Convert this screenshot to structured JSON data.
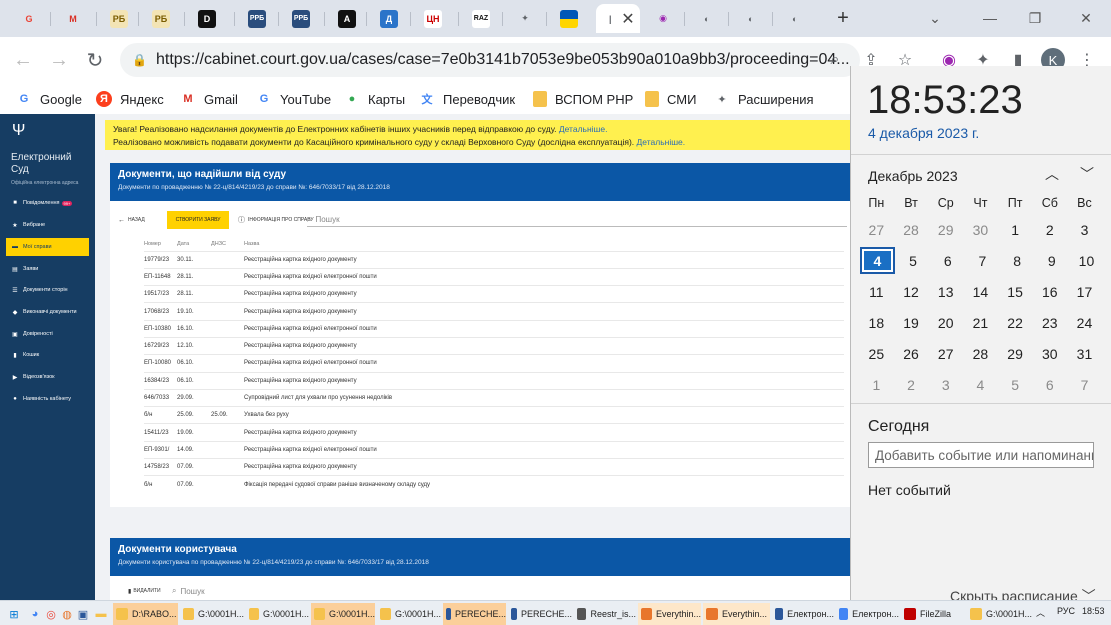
{
  "browser": {
    "tabs": [
      {
        "icon": "google-icon",
        "glyph": "G",
        "color": "#ea4335",
        "bg": "transparent"
      },
      {
        "icon": "gmail-icon",
        "glyph": "M",
        "color": "#d93025",
        "bg": "transparent"
      },
      {
        "icon": "newspaper-icon",
        "glyph": "РБ",
        "color": "#7a5c00",
        "bg": "#f3e4b5"
      },
      {
        "icon": "newspaper-icon",
        "glyph": "РБ",
        "color": "#7a5c00",
        "bg": "#f3e4b5"
      },
      {
        "icon": "site-d-icon",
        "glyph": "D",
        "color": "#fff",
        "bg": "#111"
      },
      {
        "icon": "site-rpb-icon",
        "glyph": "РРБ",
        "color": "#fff",
        "bg": "#2a4d7d"
      },
      {
        "icon": "site-rpb-icon",
        "glyph": "РРБ",
        "color": "#fff",
        "bg": "#2a4d7d"
      },
      {
        "icon": "site-a-icon",
        "glyph": "A",
        "color": "#fff",
        "bg": "#111"
      },
      {
        "icon": "site-d-blue-icon",
        "glyph": "Д",
        "color": "#fff",
        "bg": "#2b74c9"
      },
      {
        "icon": "site-cn-icon",
        "glyph": "ЦН",
        "color": "#c00",
        "bg": "#fff"
      },
      {
        "icon": "site-raz-icon",
        "glyph": "RAZ",
        "color": "#111",
        "bg": "#fff"
      },
      {
        "icon": "extension-icon",
        "glyph": "✦",
        "color": "#5f6368",
        "bg": "transparent"
      },
      {
        "icon": "ukraine-flag-icon",
        "glyph": "",
        "color": "#ffd500",
        "bg": "#0057b7"
      },
      {
        "icon": "court-emblem-icon",
        "glyph": "|",
        "color": "#5f6368",
        "bg": "transparent"
      },
      {
        "icon": "multicolor-circle-icon",
        "glyph": "◉",
        "color": "#9c27b0",
        "bg": "transparent"
      },
      {
        "icon": "globe-icon",
        "glyph": "◐",
        "color": "#5f6368",
        "bg": "transparent"
      },
      {
        "icon": "globe-icon",
        "glyph": "◐",
        "color": "#5f6368",
        "bg": "transparent"
      },
      {
        "icon": "globe-icon",
        "glyph": "◐",
        "color": "#5f6368",
        "bg": "transparent"
      }
    ],
    "url": "https://cabinet.court.gov.ua/cases/case=7e0b3141b7053e9be053b90a010a9bb3/proceeding=04...",
    "profile_initial": "K",
    "bookmarks": [
      {
        "label": "Google",
        "icon": "google-icon",
        "glyph": "G",
        "color": "#4285f4"
      },
      {
        "label": "Яндекс",
        "icon": "yandex-icon",
        "glyph": "Я",
        "color": "#fc3f1d"
      },
      {
        "label": "Gmail",
        "icon": "gmail-icon",
        "glyph": "M",
        "color": "#d93025"
      },
      {
        "label": "YouTube",
        "icon": "google-icon",
        "glyph": "G",
        "color": "#4285f4"
      },
      {
        "label": "Карты",
        "icon": "map-pin-icon",
        "glyph": "●",
        "color": "#34a853"
      },
      {
        "label": "Переводчик",
        "icon": "translate-icon",
        "glyph": "文",
        "color": "#4285f4"
      },
      {
        "label": "ВСПОМ РНР",
        "icon": "folder-icon",
        "glyph": "",
        "color": "#f5c24c"
      },
      {
        "label": "СМИ",
        "icon": "folder-icon",
        "glyph": "",
        "color": "#f5c24c"
      },
      {
        "label": "Расширения",
        "icon": "puzzle-icon",
        "glyph": "✦",
        "color": "#5f6368"
      }
    ]
  },
  "site": {
    "brand_line1": "Електронний",
    "brand_line2": "Суд",
    "brand_sub": "Офіційна електронна адреса",
    "nav": [
      {
        "label": "Повідомлення",
        "icon": "message-icon",
        "glyph": "■",
        "badge": "99+"
      },
      {
        "label": "Вибране",
        "icon": "star-icon",
        "glyph": "★",
        "badge": ""
      },
      {
        "label": "Мої справи",
        "icon": "folder-icon",
        "glyph": "▬",
        "badge": "",
        "active": true
      },
      {
        "label": "Заяви",
        "icon": "document-icon",
        "glyph": "▤",
        "badge": ""
      },
      {
        "label": "Документи сторін",
        "icon": "list-icon",
        "glyph": "☰",
        "badge": ""
      },
      {
        "label": "Виконавчі документи",
        "icon": "gavel-icon",
        "glyph": "◆",
        "badge": ""
      },
      {
        "label": "Довіреності",
        "icon": "proxy-icon",
        "glyph": "▣",
        "badge": ""
      },
      {
        "label": "Кошик",
        "icon": "trash-icon",
        "glyph": "▮",
        "badge": ""
      },
      {
        "label": "Відеозв'язок",
        "icon": "video-icon",
        "glyph": "▶",
        "badge": ""
      },
      {
        "label": "Наявність кабінету",
        "icon": "user-icon",
        "glyph": "●",
        "badge": ""
      }
    ],
    "notice": {
      "line1": "Увага! Реалізовано надсилання документів до Електронних кабінетів інших учасників перед відправкою до суду.",
      "line2": "Реалізовано можливість подавати документи до Касаційного кримінального суду у складі Верховного Суду (дослідна експлуатація).",
      "more": "Детальніше."
    },
    "docs": {
      "title": "Документи, що надійшли від суду",
      "subtitle": "Документи по провадженню № 22-ц/814/4219/23 до справи №: 646/7033/17 від 28.12.2018",
      "back_label": "НАЗАД",
      "create_label": "СТВОРИТИ ЗАЯВУ",
      "info_label": "ІНФОРМАЦІЯ ПРО СПРАВУ",
      "search_placeholder": "Пошук",
      "columns": [
        "Номер",
        "Дата",
        "ДНЗС",
        "Назва"
      ],
      "rows": [
        [
          "19779/23",
          "30.11.",
          "",
          "Реєстраційна картка вхідного документу"
        ],
        [
          "ЕП-11648",
          "28.11.",
          "",
          "Реєстраційна картка вхідної електронної пошти"
        ],
        [
          "19517/23",
          "28.11.",
          "",
          "Реєстраційна картка вхідного документу"
        ],
        [
          "17068/23",
          "19.10.",
          "",
          "Реєстраційна картка вхідного документу"
        ],
        [
          "ЕП-10380",
          "16.10.",
          "",
          "Реєстраційна картка вхідної електронної пошти"
        ],
        [
          "16729/23",
          "12.10.",
          "",
          "Реєстраційна картка вхідного документу"
        ],
        [
          "ЕП-10080",
          "06.10.",
          "",
          "Реєстраційна картка вхідної електронної пошти"
        ],
        [
          "16384/23",
          "06.10.",
          "",
          "Реєстраційна картка вхідного документу"
        ],
        [
          "646/7033",
          "29.09.",
          "",
          "Супровідний лист для ухвали про усунення недоліків"
        ],
        [
          "б/н",
          "25.09.",
          "25.09.",
          "Ухвала без руху"
        ],
        [
          "15411/23",
          "19.09.",
          "",
          "Реєстраційна картка вхідного документу"
        ],
        [
          "ЕП-9301/",
          "14.09.",
          "",
          "Реєстраційна картка вхідної електронної пошти"
        ],
        [
          "14758/23",
          "07.09.",
          "",
          "Реєстраційна картка вхідного документу"
        ],
        [
          "б/н",
          "07.09.",
          "",
          "Фіксація передачі судової справи раніше визначеному складу суду"
        ]
      ]
    },
    "user_docs": {
      "title": "Документи користувача",
      "subtitle": "Документи користувача по провадженню № 22-ц/814/4219/23 до справи №: 646/7033/17 від 28.12.2018",
      "delete_label": "ВИДАЛИТИ",
      "search_placeholder": "Пошук"
    }
  },
  "calendar": {
    "time": "18:53:23",
    "date": "4 декабря 2023 г.",
    "month": "Декабрь 2023",
    "weekdays": [
      "Пн",
      "Вт",
      "Ср",
      "Чт",
      "Пт",
      "Сб",
      "Вс"
    ],
    "weeks": [
      [
        [
          "27",
          1
        ],
        [
          "28",
          1
        ],
        [
          "29",
          1
        ],
        [
          "30",
          1
        ],
        [
          "1",
          0
        ],
        [
          "2",
          0
        ],
        [
          "3",
          0
        ]
      ],
      [
        [
          "4",
          2
        ],
        [
          "5",
          0
        ],
        [
          "6",
          0
        ],
        [
          "7",
          0
        ],
        [
          "8",
          0
        ],
        [
          "9",
          0
        ],
        [
          "10",
          0
        ]
      ],
      [
        [
          "11",
          0
        ],
        [
          "12",
          0
        ],
        [
          "13",
          0
        ],
        [
          "14",
          0
        ],
        [
          "15",
          0
        ],
        [
          "16",
          0
        ],
        [
          "17",
          0
        ]
      ],
      [
        [
          "18",
          0
        ],
        [
          "19",
          0
        ],
        [
          "20",
          0
        ],
        [
          "21",
          0
        ],
        [
          "22",
          0
        ],
        [
          "23",
          0
        ],
        [
          "24",
          0
        ]
      ],
      [
        [
          "25",
          0
        ],
        [
          "26",
          0
        ],
        [
          "27",
          0
        ],
        [
          "28",
          0
        ],
        [
          "29",
          0
        ],
        [
          "30",
          0
        ],
        [
          "31",
          0
        ]
      ],
      [
        [
          "1",
          1
        ],
        [
          "2",
          1
        ],
        [
          "3",
          1
        ],
        [
          "4",
          1
        ],
        [
          "5",
          1
        ],
        [
          "6",
          1
        ],
        [
          "7",
          1
        ]
      ]
    ],
    "today_label": "Сегодня",
    "event_placeholder": "Добавить событие или напоминание",
    "no_events": "Нет событий",
    "hide_schedule": "Скрыть расписание"
  },
  "taskbar": {
    "tasks": [
      {
        "label": "D:\\RABO...",
        "icon": "folder-icon",
        "color": "#f5c24c",
        "style": "hl"
      },
      {
        "label": "G:\\0001H...",
        "icon": "folder-icon",
        "color": "#f5c24c",
        "style": ""
      },
      {
        "label": "G:\\0001H...",
        "icon": "folder-icon",
        "color": "#f5c24c",
        "style": ""
      },
      {
        "label": "G:\\0001H...",
        "icon": "folder-icon",
        "color": "#f5c24c",
        "style": "hl"
      },
      {
        "label": "G:\\0001H...",
        "icon": "folder-icon",
        "color": "#f5c24c",
        "style": ""
      },
      {
        "label": "PERECHE...",
        "icon": "document-icon",
        "color": "#2b579a",
        "style": "hl"
      },
      {
        "label": "PERECHE...",
        "icon": "word-icon",
        "color": "#2b579a",
        "style": ""
      },
      {
        "label": "Reestr_is...",
        "icon": "document-icon",
        "color": "#555",
        "style": ""
      },
      {
        "label": "Everythin...",
        "icon": "search-icon",
        "color": "#e8762c",
        "style": "hl2"
      },
      {
        "label": "Everythin...",
        "icon": "search-icon",
        "color": "#e8762c",
        "style": "hl2"
      },
      {
        "label": "Електрон...",
        "icon": "word-icon",
        "color": "#2b579a",
        "style": ""
      },
      {
        "label": "Електрон...",
        "icon": "chrome-icon",
        "color": "#4285f4",
        "style": ""
      },
      {
        "label": "FileZilla",
        "icon": "filezilla-icon",
        "color": "#bf0000",
        "style": ""
      },
      {
        "label": "G:\\0001H...",
        "icon": "folder-icon",
        "color": "#f5c24c",
        "style": ""
      }
    ],
    "lang": "РУС",
    "clock": "18:53"
  }
}
